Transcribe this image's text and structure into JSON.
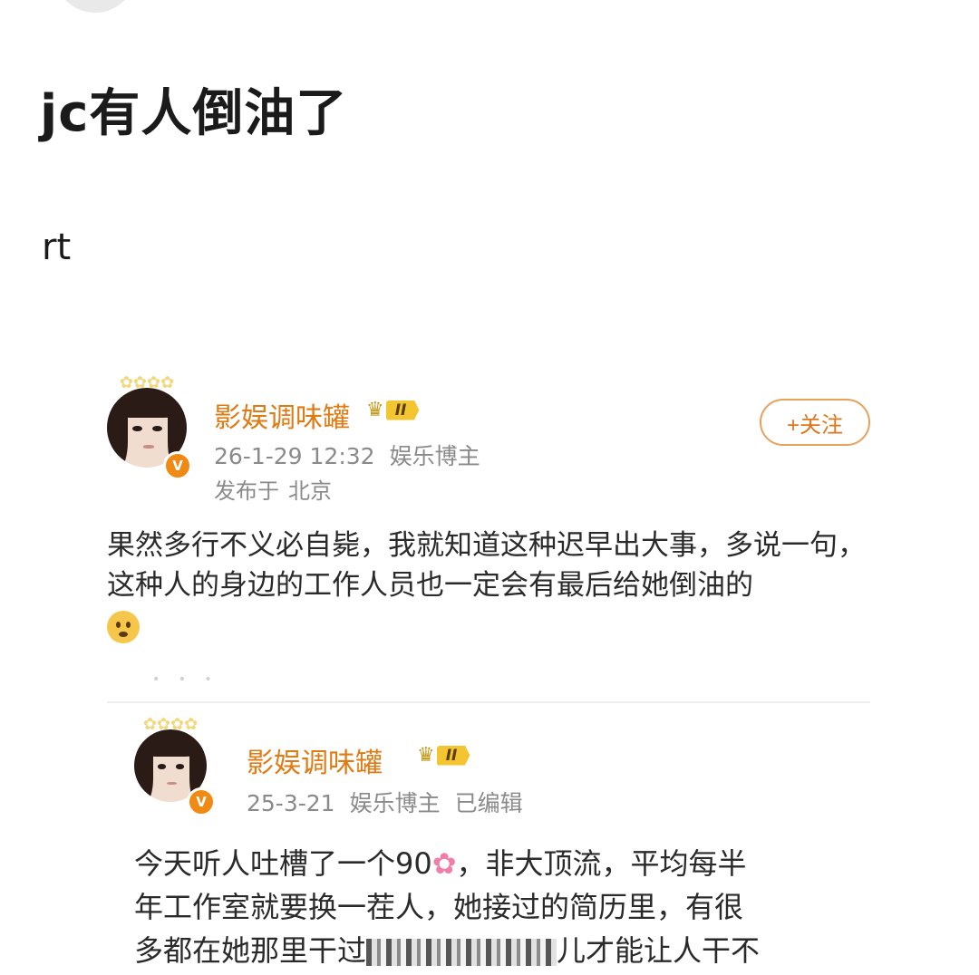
{
  "post": {
    "title": "jc有人倒油了",
    "body": "rt"
  },
  "card1": {
    "username": "影娱调味罐",
    "level_badge": "II",
    "timestamp": "26-1-29 12:32",
    "user_tag": "娱乐博主",
    "location_prefix": "发布于",
    "location": "北京",
    "follow_label": "+关注",
    "text": "果然多行不义必自毙，我就知道这种迟早出大事，多说一句，这种人的身边的工作人员也一定会有最后给她倒油的",
    "emoji": "frowning-face"
  },
  "card2": {
    "username": "影娱调味罐",
    "level_badge": "II",
    "timestamp": "25-3-21",
    "user_tag": "娱乐博主",
    "edited": "已编辑",
    "text_line1_a": "今天听人吐槽了一个90",
    "text_line1_b": "，非大顶流，平均每半",
    "text_line2": "年工作室就要换一茬人，她接过的简历里，有很",
    "text_line3_a": "多都在她那里干过",
    "text_line3_b": "儿才能让人干不",
    "emoji": "cherry-blossom"
  },
  "colors": {
    "username": "#e07a12",
    "verified": "#f08a14",
    "follow_border": "#e6a15d",
    "meta": "#8a8a8a"
  }
}
